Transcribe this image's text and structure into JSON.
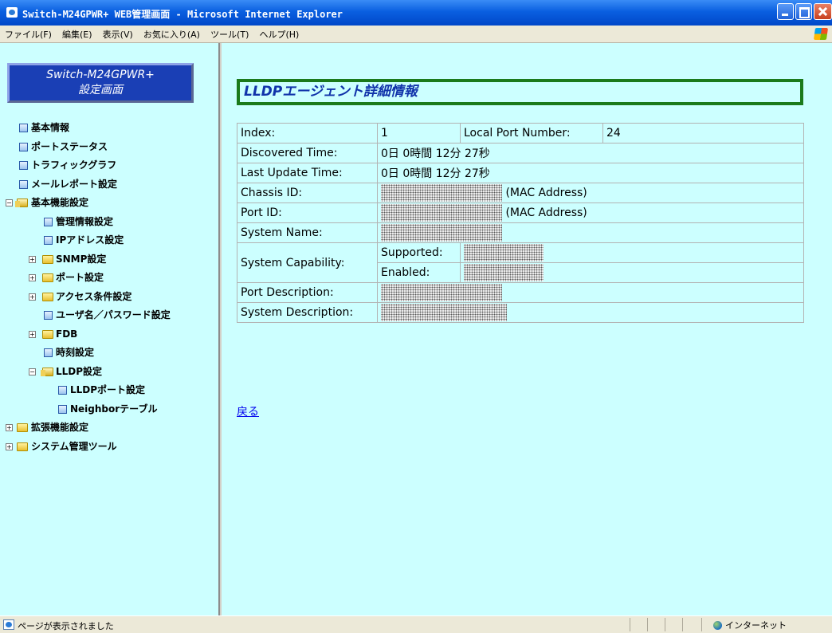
{
  "window": {
    "title": "Switch-M24GPWR+ WEB管理画面 - Microsoft Internet Explorer"
  },
  "menubar": {
    "items": [
      "ファイル(F)",
      "編集(E)",
      "表示(V)",
      "お気に入り(A)",
      "ツール(T)",
      "ヘルプ(H)"
    ]
  },
  "sidebar": {
    "logo_line1": "Switch-M24GPWR+",
    "logo_line2": "設定画面",
    "items": [
      {
        "label": "基本情報",
        "icon": "page-icon"
      },
      {
        "label": "ポートステータス",
        "icon": "page-icon"
      },
      {
        "label": "トラフィックグラフ",
        "icon": "page-icon"
      },
      {
        "label": "メールレポート設定",
        "icon": "page-icon"
      },
      {
        "label": "基本機能設定",
        "icon": "folder-open-icon",
        "toggle": "⊟"
      },
      {
        "label": "管理情報設定",
        "icon": "page-icon"
      },
      {
        "label": "IPアドレス設定",
        "icon": "page-icon"
      },
      {
        "label": "SNMP設定",
        "icon": "folder-icon",
        "toggle": "⊞"
      },
      {
        "label": "ポート設定",
        "icon": "folder-icon",
        "toggle": "⊞"
      },
      {
        "label": "アクセス条件設定",
        "icon": "folder-icon",
        "toggle": "⊞"
      },
      {
        "label": "ユーザ名／パスワード設定",
        "icon": "page-icon"
      },
      {
        "label": "FDB",
        "icon": "folder-icon",
        "toggle": "⊞"
      },
      {
        "label": "時刻設定",
        "icon": "page-icon"
      },
      {
        "label": "LLDP設定",
        "icon": "folder-open-icon",
        "toggle": "⊟"
      },
      {
        "label": "LLDPポート設定",
        "icon": "page-icon"
      },
      {
        "label": "Neighborテーブル",
        "icon": "page-icon"
      },
      {
        "label": "拡張機能設定",
        "icon": "folder-icon",
        "toggle": "⊞"
      },
      {
        "label": "システム管理ツール",
        "icon": "folder-icon",
        "toggle": "⊞"
      }
    ]
  },
  "main": {
    "heading": "LLDPエージェント詳細情報",
    "rows": {
      "index_label": "Index:",
      "index_value": "1",
      "local_port_label": "Local Port Number:",
      "local_port_value": "24",
      "discovered_label": "Discovered Time:",
      "discovered_value": "0日 0時間 12分 27秒",
      "last_update_label": "Last Update Time:",
      "last_update_value": "0日 0時間 12分 27秒",
      "chassis_label": "Chassis ID:",
      "chassis_suffix": "(MAC Address)",
      "port_id_label": "Port ID:",
      "port_id_suffix": "(MAC Address)",
      "system_name_label": "System Name:",
      "capability_label": "System Capability:",
      "supported_label": "Supported:",
      "enabled_label": "Enabled:",
      "port_desc_label": "Port Description:",
      "system_desc_label": "System Description:"
    },
    "back_link": "戻る"
  },
  "statusbar": {
    "text": "ページが表示されました",
    "zone": "インターネット"
  }
}
